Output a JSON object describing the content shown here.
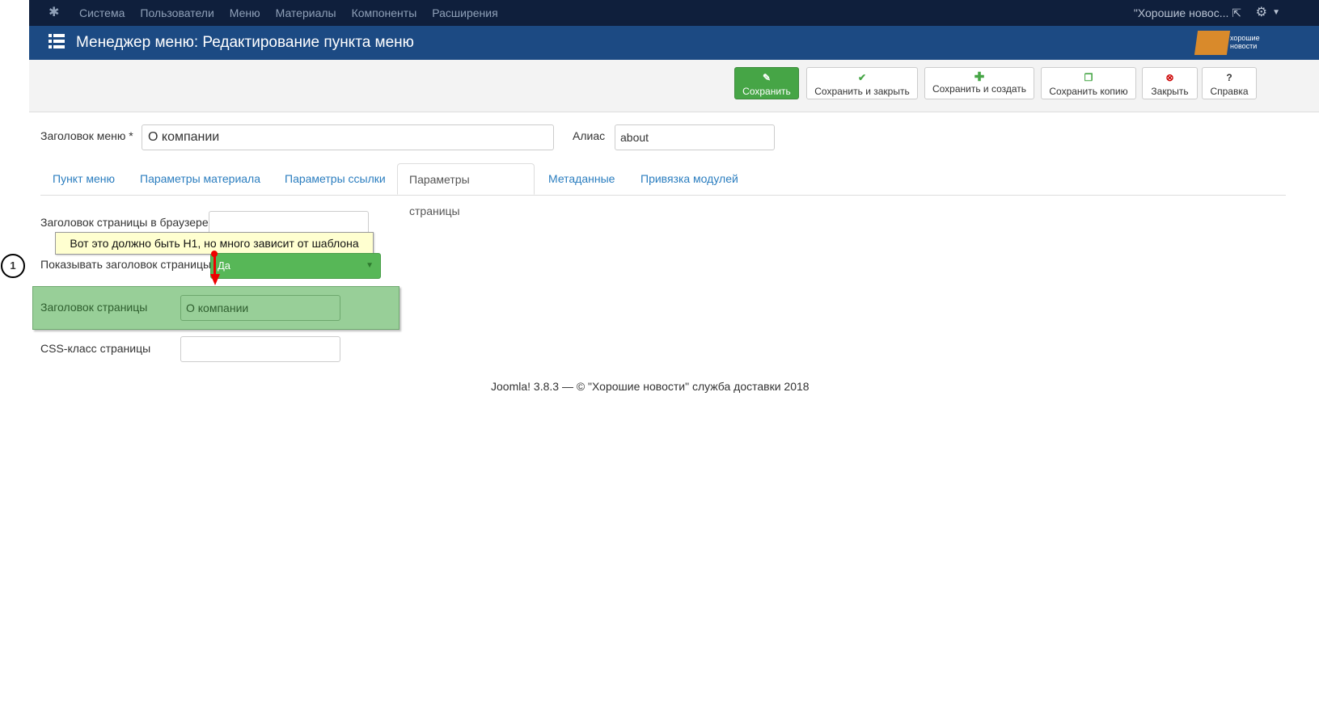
{
  "topbar": {
    "nav": [
      "Система",
      "Пользователи",
      "Меню",
      "Материалы",
      "Компоненты",
      "Расширения"
    ],
    "site_link": "\"Хорошие новос...",
    "external_icon": "external-link-icon",
    "settings_icon": "gear-icon"
  },
  "header": {
    "title": "Менеджер меню: Редактирование пункта меню",
    "logo_text": "хорошие новости"
  },
  "toolbar": {
    "save": "Сохранить",
    "save_close": "Сохранить и закрыть",
    "save_new": "Сохранить и создать",
    "save_copy": "Сохранить копию",
    "close": "Закрыть",
    "help": "Справка"
  },
  "form": {
    "title_label": "Заголовок меню *",
    "title_value": "О компании",
    "alias_label": "Алиас",
    "alias_value": "about"
  },
  "tabs": [
    "Пункт меню",
    "Параметры материала",
    "Параметры ссылки",
    "Параметры страницы",
    "Метаданные",
    "Привязка модулей"
  ],
  "active_tab": "Параметры страницы",
  "page_params": {
    "browser_title_label": "Заголовок страницы в браузере",
    "browser_title_value": "",
    "tooltip": "Вот это должно быть H1, но много зависит от шаблона",
    "show_heading_label": "Показывать заголовок страницы",
    "show_heading_value": "Да",
    "page_heading_label": "Заголовок страницы",
    "page_heading_value": "О компании",
    "css_class_label": "CSS-класс страницы",
    "css_class_value": ""
  },
  "annotation": {
    "step": "1"
  },
  "footer": "Joomla! 3.8.3  —  © \"Хорошие новости\" служба доставки 2018",
  "colors": {
    "topbar": "#0f1f3c",
    "header": "#1c4a83",
    "save_button": "#46a546",
    "highlight": "#98cf98",
    "link": "#2a7dbf",
    "arrow": "#e00000"
  }
}
